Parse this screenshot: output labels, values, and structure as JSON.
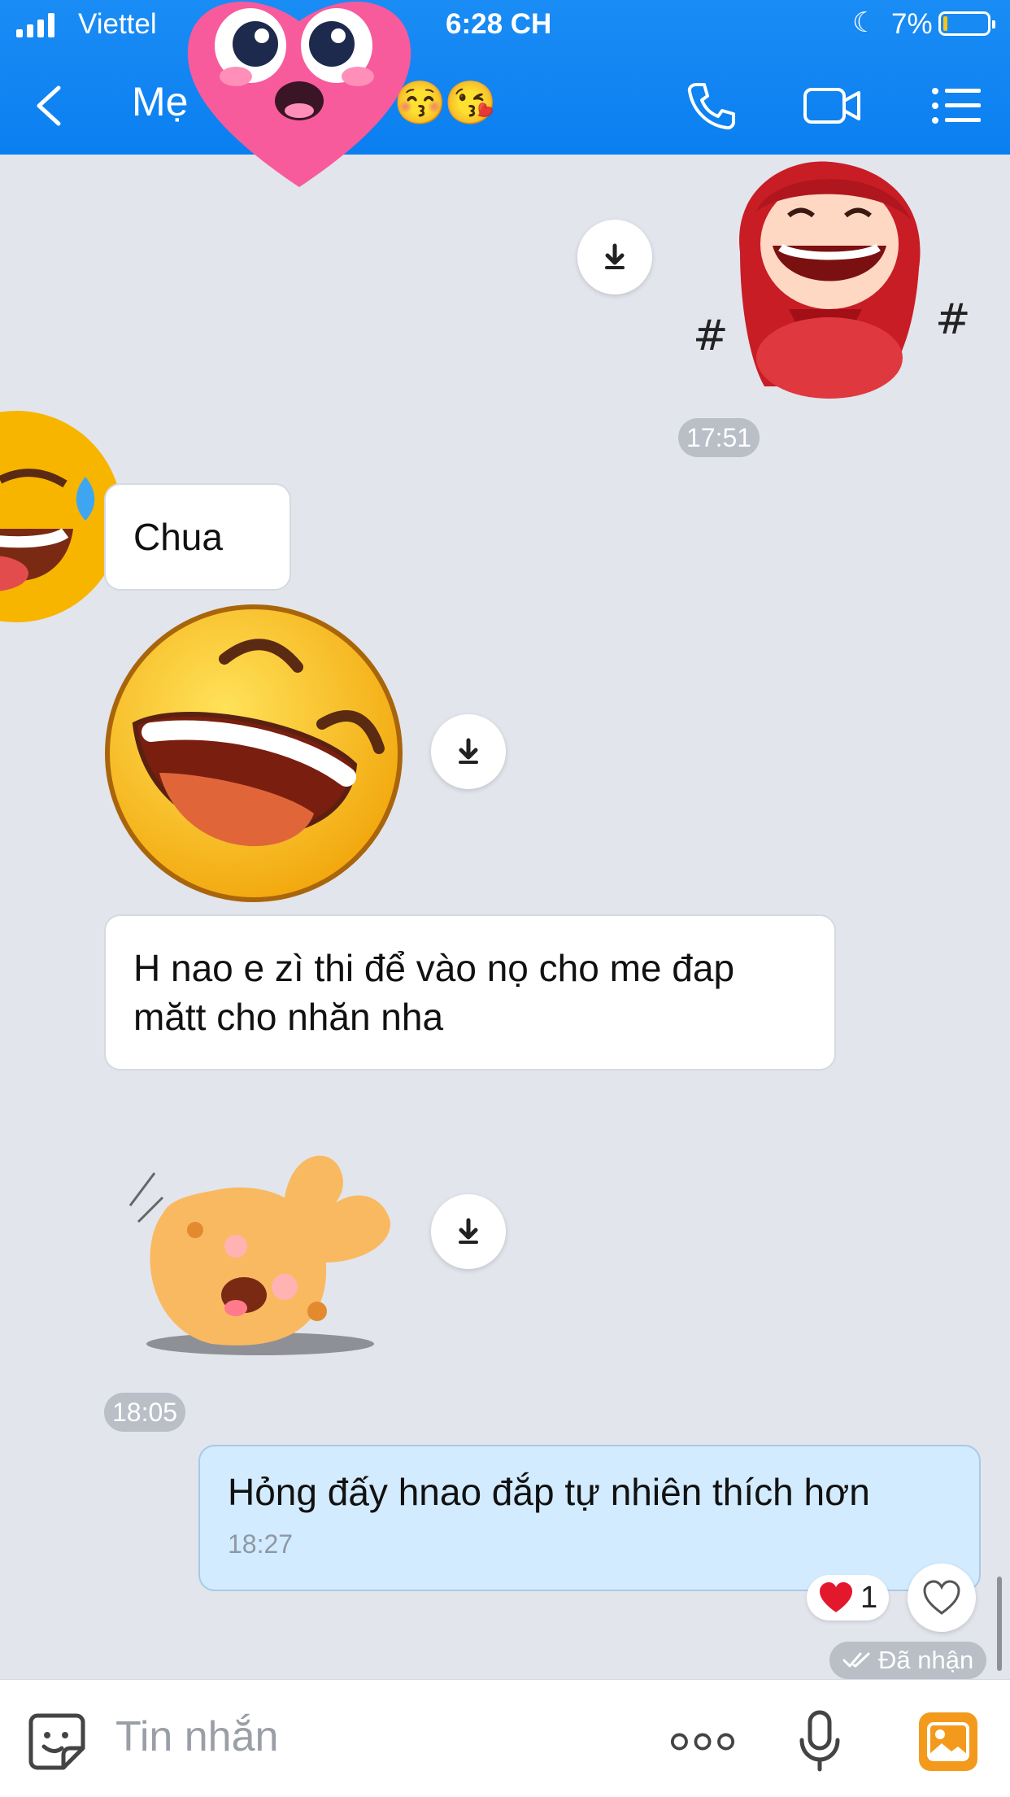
{
  "status_bar": {
    "carrier": "Viettel",
    "time": "6:28 CH",
    "battery_percent": "7%",
    "battery_level": 0.07
  },
  "header": {
    "back_icon": "chevron-left-icon",
    "contact_name": "Mẹ",
    "name_emojis": [
      "😚",
      "😘"
    ],
    "call_icon": "phone-icon",
    "video_icon": "video-camera-icon",
    "menu_icon": "list-menu-icon"
  },
  "messages": [
    {
      "from": "me",
      "kind": "sticker",
      "sticker": "red-hood-laughing-girl-sticker"
    },
    {
      "kind": "timestamp",
      "text": "17:51"
    },
    {
      "from": "contact",
      "kind": "text",
      "text": "Chua"
    },
    {
      "from": "contact",
      "kind": "sticker",
      "sticker": "laughing-face-sticker"
    },
    {
      "from": "contact",
      "kind": "text",
      "text": "H nao e zì thi để vào nọ cho me đap mătt cho nhăn nha"
    },
    {
      "from": "contact",
      "kind": "sticker",
      "sticker": "laughing-bunny-sticker"
    },
    {
      "kind": "timestamp",
      "text": "18:05"
    },
    {
      "from": "me",
      "kind": "text",
      "text": "Hỏng đấy hnao đắp tự nhiên thích hơn",
      "time": "18:27"
    }
  ],
  "reaction": {
    "icon": "red-heart-icon",
    "count": "1"
  },
  "delivery_status": "Đã nhận",
  "input": {
    "placeholder": "Tin nhắn",
    "sticker_icon": "sticker-smile-icon",
    "more_icon": "more-dots-icon",
    "mic_icon": "microphone-icon",
    "image_icon": "image-gallery-icon"
  },
  "colors": {
    "header_blue": "#0a7ff0",
    "chat_background": "#e2e5ec",
    "outgoing_bubble": "#d3ebff",
    "incoming_bubble": "#ffffff",
    "timestamp_chip": "#b9bec7",
    "image_button_orange": "#f39a1c"
  }
}
